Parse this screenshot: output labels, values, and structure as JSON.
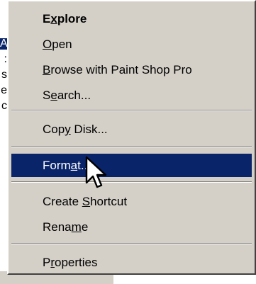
{
  "background": {
    "lines": [
      {
        "text": "A",
        "selected": true
      },
      {
        "text": ":",
        "selected": false
      },
      {
        "text": "s",
        "selected": false
      },
      {
        "text": "e",
        "selected": false
      },
      {
        "text": "c",
        "selected": false
      }
    ]
  },
  "menu": {
    "items": [
      {
        "label": "Explore",
        "accel": "x",
        "bold": true
      },
      {
        "label": "Open",
        "accel": "O"
      },
      {
        "label": "Browse with Paint Shop Pro",
        "accel": "B"
      },
      {
        "label": "Search...",
        "accel": "e"
      },
      {
        "label": "Copy Disk...",
        "accel": "y"
      },
      {
        "label": "Format...",
        "accel": "a",
        "highlighted": true
      },
      {
        "label": "Create Shortcut",
        "accel": "S"
      },
      {
        "label": "Rename",
        "accel": "m"
      },
      {
        "label": "Properties",
        "accel": "r"
      }
    ]
  },
  "colors": {
    "menu_bg": "#d4d0c8",
    "highlight": "#0a246a",
    "highlight_text": "#ffffff"
  },
  "cursor": {
    "icon": "arrow-pointer-icon"
  }
}
